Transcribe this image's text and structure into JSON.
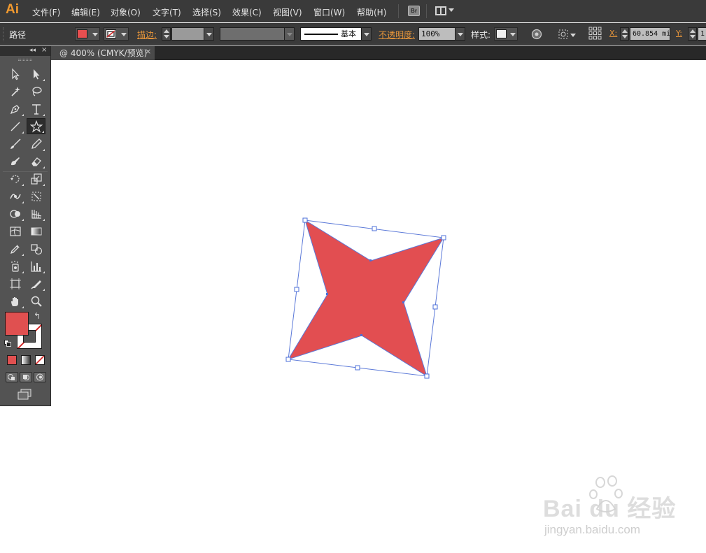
{
  "app": {
    "logo": "Ai"
  },
  "menu": {
    "items": [
      {
        "label": "文件(F)"
      },
      {
        "label": "编辑(E)"
      },
      {
        "label": "对象(O)"
      },
      {
        "label": "文字(T)"
      },
      {
        "label": "选择(S)"
      },
      {
        "label": "效果(C)"
      },
      {
        "label": "视图(V)"
      },
      {
        "label": "窗口(W)"
      },
      {
        "label": "帮助(H)"
      }
    ],
    "bridge_label": "Br"
  },
  "control": {
    "object_type": "路径",
    "fill_color": "#e84f50",
    "stroke_label": "描边:",
    "stroke_weight": "",
    "brush_label": "基本",
    "opacity_label": "不透明度:",
    "opacity_value": "100%",
    "style_label": "样式:",
    "x_label": "X:",
    "x_value": "60.854 mi",
    "y_label": "Y:",
    "y_value": "1"
  },
  "document": {
    "tab_title": "@ 400% (CMYK/预览)",
    "close_glyph": "×"
  },
  "tools_panel": {
    "collapse_glyph": "◂◂",
    "close_glyph": "×",
    "active_tool": "star-tool",
    "fill_color": "#e05050",
    "stroke_color": "none",
    "tools": [
      "selection-tool",
      "direct-selection-tool",
      "magic-wand-tool",
      "lasso-tool",
      "pen-tool",
      "type-tool",
      "line-segment-tool",
      "star-tool",
      "paintbrush-tool",
      "pencil-tool",
      "blob-brush-tool",
      "eraser-tool",
      "rotate-tool",
      "scale-tool",
      "width-tool",
      "free-transform-tool",
      "shape-builder-tool",
      "perspective-grid-tool",
      "mesh-tool",
      "gradient-tool",
      "eyedropper-tool",
      "blend-tool",
      "symbol-sprayer-tool",
      "column-graph-tool",
      "artboard-tool",
      "slice-tool",
      "hand-tool",
      "zoom-tool"
    ]
  },
  "artwork": {
    "shape": "four-point-star",
    "fill": "#e24e51",
    "selection_color": "#4b6fd8"
  },
  "watermark": {
    "logo_text": "Bai du 经验",
    "sub_text": "jingyan.baidu.com"
  }
}
